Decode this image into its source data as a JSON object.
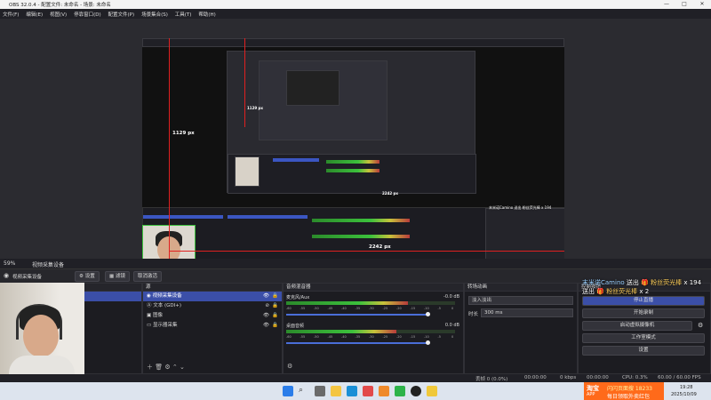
{
  "window": {
    "title": "OBS 32.0.4 - 配置文件: 未命名 - 场景: 未命名",
    "min": "—",
    "max": "□",
    "close": "✕"
  },
  "menu": [
    "文件(F)",
    "编辑(E)",
    "视图(V)",
    "停靠窗口(D)",
    "配置文件(P)",
    "场景集合(S)",
    "工具(T)",
    "帮助(H)"
  ],
  "preview": {
    "width_label": "2242 px",
    "height_label": "1129 px",
    "inner_width_label": "2242 px",
    "inner_height_label": "1129 px"
  },
  "source_bar": {
    "zoom": "59%",
    "label": "视频采集设备"
  },
  "toolbar": {
    "source_name": "视频采集设备",
    "properties": "设置",
    "filters": "滤镜",
    "deactivate": "取消激活"
  },
  "scenes": {
    "header": "场景",
    "items": [
      "场景"
    ]
  },
  "sources": {
    "header": "源",
    "items": [
      {
        "icon": "camera-icon",
        "label": "视频采集设备",
        "selected": true
      },
      {
        "icon": "text-icon",
        "label": "文本 (GDI+)",
        "selected": false
      },
      {
        "icon": "image-icon",
        "label": "图像",
        "selected": false
      },
      {
        "icon": "monitor-icon",
        "label": "显示器采集",
        "selected": false
      }
    ]
  },
  "mixer": {
    "header": "音频混音器",
    "channels": [
      {
        "name": "麦克风/Aux",
        "db": "-0.0 dB",
        "level": 0.72
      },
      {
        "name": "桌面音频",
        "db": "0.0 dB",
        "level": 0.65
      }
    ],
    "ticks": [
      "-60",
      "-55",
      "-50",
      "-45",
      "-40",
      "-35",
      "-30",
      "-25",
      "-20",
      "-15",
      "-10",
      "-5",
      "0"
    ]
  },
  "transitions": {
    "header": "转场动画",
    "type": "淡入淡出",
    "duration_label": "时长",
    "duration": "300 ms"
  },
  "controls": {
    "header": "控制按钮",
    "stop_stream": "停止直播",
    "start_recording": "开始录制",
    "start_virtualcam": "启动虚拟摄像机",
    "studio_mode": "工作室模式",
    "settings": "设置"
  },
  "danmaku": [
    {
      "user": "末米诺Camino",
      "action": "送出",
      "gift": "粉丝荧光棒",
      "count": "x 194"
    },
    {
      "user": "",
      "action": "送出",
      "gift": "粉丝荧光棒",
      "count": "x 2"
    }
  ],
  "status": {
    "dropped": "丢帧 0 (0.0%)",
    "live_time": "00:00:00",
    "bitrate": "0 kbps",
    "rec_time": "00:00:00",
    "cpu": "CPU: 0.3%",
    "fps": "60.00 / 60.00 FPS"
  },
  "ad": {
    "brand": "淘宝",
    "brand_sub": "APP",
    "line1": "闪闪页面搜 18233",
    "line2": "每日领取外卖红包"
  },
  "taskbar": {
    "time": "19:28",
    "date": "2025/10/09"
  },
  "colors": {
    "accent": "#3b4fa8",
    "danger": "#e02020",
    "meter_green": "#3cc13c"
  }
}
